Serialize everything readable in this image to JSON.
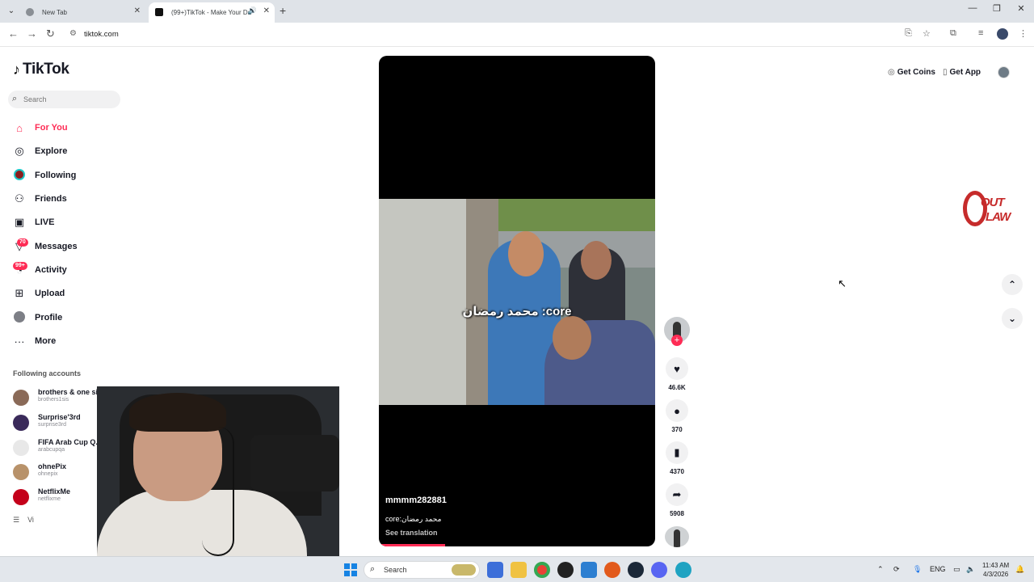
{
  "browser": {
    "tabs": [
      {
        "title": "New Tab"
      },
      {
        "title": "(99+)TikTok - Make Your Da"
      }
    ],
    "url": "tiktok.com"
  },
  "sidebar": {
    "logo": "TikTok",
    "search_placeholder": "Search",
    "nav": [
      {
        "label": "For You",
        "icon": "home-icon",
        "active": true
      },
      {
        "label": "Explore",
        "icon": "compass-icon"
      },
      {
        "label": "Following",
        "icon": "following-avatar-icon"
      },
      {
        "label": "Friends",
        "icon": "friends-icon"
      },
      {
        "label": "LIVE",
        "icon": "live-icon"
      },
      {
        "label": "Messages",
        "icon": "messages-icon",
        "badge": "70"
      },
      {
        "label": "Activity",
        "icon": "activity-icon",
        "badge": "99+"
      },
      {
        "label": "Upload",
        "icon": "upload-icon"
      },
      {
        "label": "Profile",
        "icon": "profile-icon"
      },
      {
        "label": "More",
        "icon": "more-icon"
      }
    ],
    "following_title": "Following accounts",
    "accounts": [
      {
        "name": "brothers & one sister",
        "handle": "brothers1sis"
      },
      {
        "name": "Surprise'3rd",
        "handle": "surprise3rd"
      },
      {
        "name": "FIFA Arab Cup Q...",
        "handle": "arabcupqa"
      },
      {
        "name": "ohnePix",
        "handle": "ohnepix"
      },
      {
        "name": "NetflixMe",
        "handle": "netflixme"
      }
    ],
    "view_all": "Vi"
  },
  "video": {
    "caption_overlay": "core: محمد رمضان",
    "username": "mmmm282881",
    "description": "core:محمد رمضان",
    "see_translation": "See translation",
    "progress": 0.24
  },
  "actions": {
    "likes": "46.6K",
    "comments": "370",
    "saves": "4370",
    "shares": "5908"
  },
  "header": {
    "get_coins": "Get Coins",
    "get_app": "Get App"
  },
  "watermark": {
    "line1": "OUT",
    "line2": "LAW"
  },
  "taskbar": {
    "search": "Search",
    "lang": "ENG",
    "time": "11:43 AM",
    "date": "4/3/2026"
  },
  "colors": {
    "accent": "#fe2c55",
    "text": "#161823"
  }
}
